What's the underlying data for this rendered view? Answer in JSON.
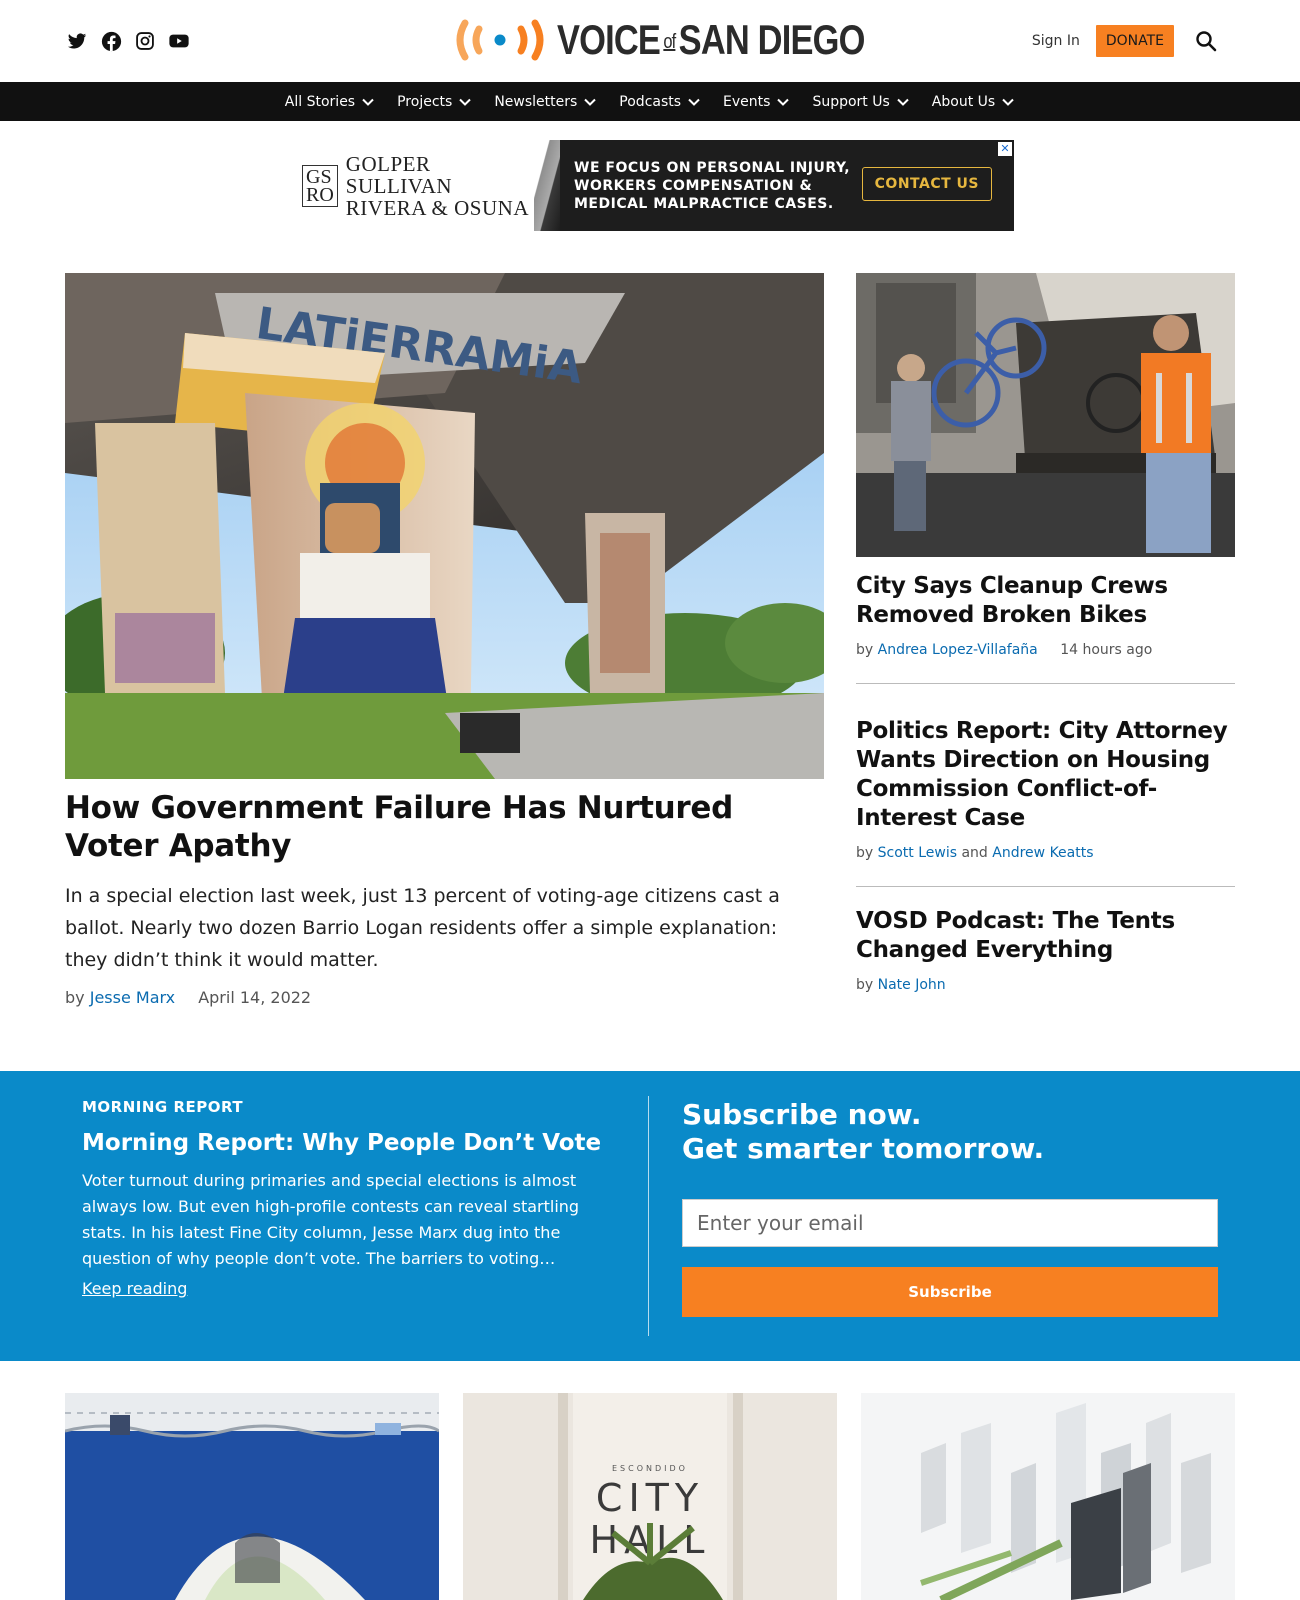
{
  "header": {
    "social": [
      "twitter-icon",
      "facebook-icon",
      "instagram-icon",
      "youtube-icon"
    ],
    "logo_main": "VOICE",
    "logo_of": "of",
    "logo_place": "SAN DIEGO",
    "signin_label": "Sign In",
    "donate_label": "DONATE",
    "colors": {
      "donate": "#f78021",
      "logo_orange": "#f7a65a",
      "logo_blue": "#0a8ac9"
    }
  },
  "nav": {
    "items": [
      {
        "label": "All Stories"
      },
      {
        "label": "Projects"
      },
      {
        "label": "Newsletters"
      },
      {
        "label": "Podcasts"
      },
      {
        "label": "Events"
      },
      {
        "label": "Support Us"
      },
      {
        "label": "About Us"
      }
    ]
  },
  "ad": {
    "monogram_top": "GS",
    "monogram_bottom": "RO",
    "firm_line1": "GOLPER SULLIVAN",
    "firm_line2": "RIVERA & OSUNA",
    "copy_line1": "WE FOCUS ON PERSONAL INJURY,",
    "copy_line2": "WORKERS COMPENSATION &",
    "copy_line3": "MEDICAL MALPRACTICE CASES.",
    "cta": "CONTACT US",
    "close": "✕"
  },
  "lead": {
    "title": "How Government Failure Has Nurtured Voter Apathy",
    "dek": "In a special election last week, just 13 percent of voting-age citizens cast a ballot. Nearly two dozen Barrio Logan residents offer a simple explanation: they didn’t think it would matter.",
    "by": "by",
    "author": "Jesse Marx",
    "date": "April 14, 2022",
    "mural_text": "LATiERRAMiA"
  },
  "side": [
    {
      "title": "City Says Cleanup Crews Removed Broken Bikes",
      "by": "by",
      "author": "Andrea Lopez-Villafaña",
      "date": "14 hours ago"
    },
    {
      "title": "Politics Report: City Attorney Wants Direction on Housing Commission Conflict-of-Interest Case",
      "by": "by",
      "author": "Scott Lewis",
      "and": "and",
      "author2": "Andrew Keatts"
    },
    {
      "title": "VOSD Podcast: The Tents Changed Everything",
      "by": "by",
      "author": "Nate John"
    }
  ],
  "morning_report": {
    "kicker": "MORNING REPORT",
    "title": "Morning Report: Why People Don’t Vote",
    "text": "Voter turnout during primaries and special elections is almost always low. But even high-profile contests can reveal startling stats.  In his latest Fine City column, Jesse Marx dug into the question of why people don’t vote.  The barriers to voting…",
    "link": "Keep reading"
  },
  "subscribe": {
    "line1": "Subscribe now.",
    "line2": "Get smarter tomorrow.",
    "placeholder": "Enter your email",
    "button": "Subscribe"
  },
  "cards": {
    "city_hall_top": "ESCONDIDO",
    "city_hall_line1": "CITY",
    "city_hall_line2": "HALL"
  }
}
